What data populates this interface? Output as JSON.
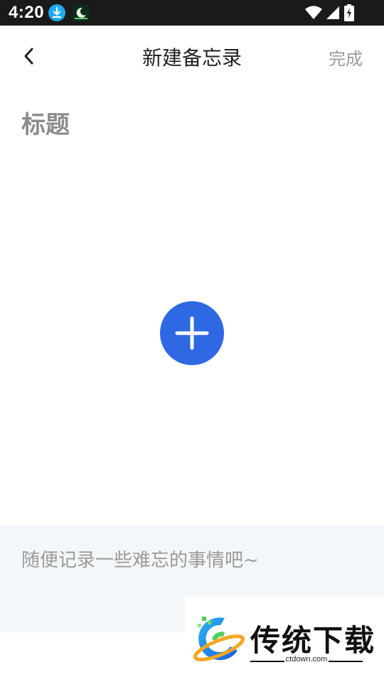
{
  "status_bar": {
    "time": "4:20",
    "icons": [
      "download-icon",
      "moon-app-icon",
      "wifi-icon",
      "signal-icon",
      "battery-charging-icon"
    ]
  },
  "header": {
    "title": "新建备忘录",
    "done_label": "完成",
    "back_icon": "chevron-left-icon"
  },
  "note": {
    "title_placeholder": "标题",
    "body_placeholder": "随便记录一些难忘的事情吧~"
  },
  "add_button": {
    "icon": "plus-icon",
    "color": "#2f68e3"
  },
  "watermark": {
    "brand": "传统下载",
    "url": "ctdown.com"
  },
  "colors": {
    "accent": "#2f68e3",
    "status_bar": "#1a1a1a",
    "content_bg": "#f4f7f9"
  }
}
